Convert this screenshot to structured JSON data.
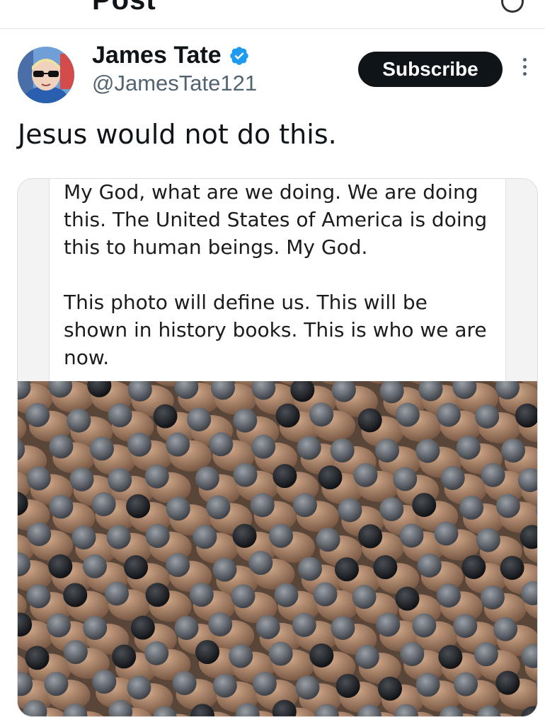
{
  "header": {
    "title": "Post"
  },
  "author": {
    "display_name": "James Tate",
    "handle": "@JamesTate121",
    "verified": true,
    "avatar_icon": "avatar-photo"
  },
  "actions": {
    "subscribe_label": "Subscribe",
    "more_icon": "more-vertical-icon"
  },
  "tweet": {
    "text": "Jesus would not do this."
  },
  "media": {
    "quote_paragraph_1": "My God, what are we doing. We are doing\nthis. The United States of America is doing\nthis to human beings. My God.",
    "quote_paragraph_2": "This photo will define us. This will be\nshown in history books. This is who we are\nnow."
  },
  "colors": {
    "subscribe_bg": "#0f1419",
    "verified": "#1d9bf0",
    "handle": "#536471"
  }
}
